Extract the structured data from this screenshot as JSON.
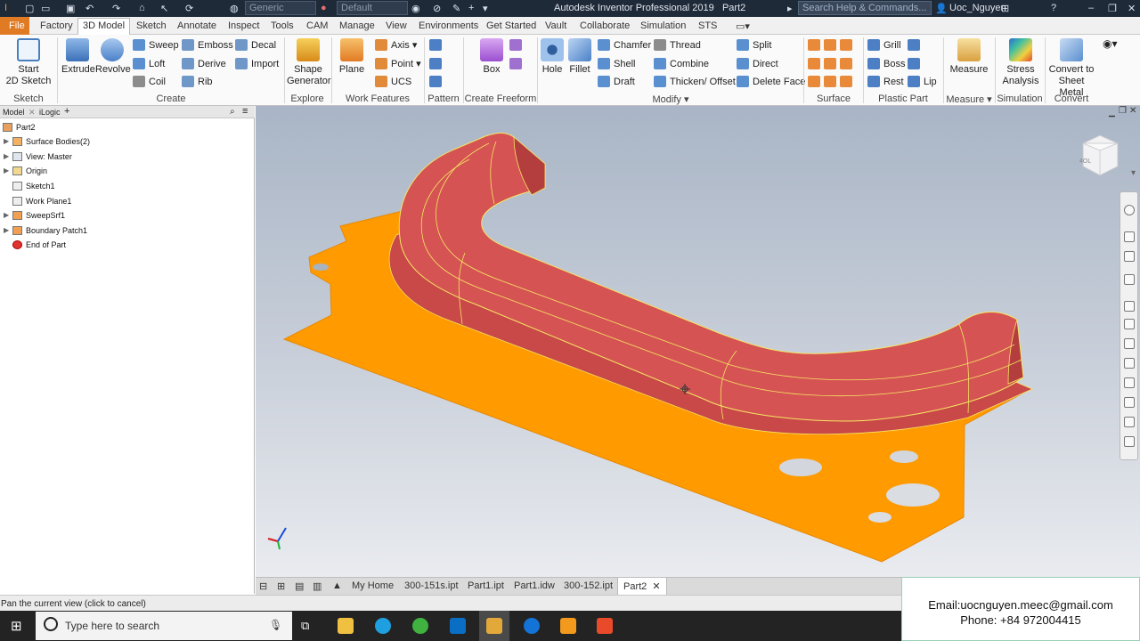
{
  "titlebar": {
    "app_title": "Autodesk Inventor Professional 2019",
    "doc_title": "Part2",
    "appearance_combo": "Generic",
    "material_combo": "Default",
    "search_placeholder": "Search Help & Commands...",
    "user": "Uoc_Nguyen"
  },
  "menu": {
    "file": "File",
    "tabs": [
      "Factory",
      "3D Model",
      "Sketch",
      "Annotate",
      "Inspect",
      "Tools",
      "CAM",
      "Manage",
      "View",
      "Environments",
      "Get Started",
      "Vault",
      "Collaborate",
      "Simulation",
      "STS"
    ],
    "active_tab": "3D Model"
  },
  "ribbon": {
    "start_sketch": "Start\n2D Sketch",
    "extrude": "Extrude",
    "revolve": "Revolve",
    "sweep": "Sweep",
    "loft": "Loft",
    "coil": "Coil",
    "emboss": "Emboss",
    "derive": "Derive",
    "rib": "Rib",
    "decal": "Decal",
    "import": "Import",
    "shape_generator": "Shape\nGenerator",
    "plane": "Plane",
    "axis": "Axis",
    "point": "Point",
    "ucs": "UCS",
    "box": "Box",
    "hole": "Hole",
    "fillet": "Fillet",
    "chamfer": "Chamfer",
    "shell": "Shell",
    "draft": "Draft",
    "thread": "Thread",
    "combine": "Combine",
    "thicken_offset": "Thicken/ Offset",
    "split": "Split",
    "direct": "Direct",
    "delete_face": "Delete Face",
    "grill": "Grill",
    "boss": "Boss",
    "rest": "Rest",
    "lip": "Lip",
    "measure": "Measure",
    "stress_analysis": "Stress\nAnalysis",
    "convert_sheet_metal": "Convert to\nSheet Metal",
    "groups": {
      "sketch": "Sketch",
      "create": "Create",
      "explore": "Explore",
      "work_features": "Work Features",
      "pattern": "Pattern",
      "create_freeform": "Create Freeform",
      "modify": "Modify",
      "surface": "Surface",
      "plastic_part": "Plastic Part",
      "measure": "Measure",
      "simulation": "Simulation",
      "convert": "Convert"
    }
  },
  "browser": {
    "tabs": [
      "Model",
      "iLogic"
    ],
    "add_tab": "+",
    "items": [
      {
        "label": "Part2",
        "icon": "part-icon"
      },
      {
        "label": "Surface Bodies(2)",
        "icon": "surface-bodies-icon"
      },
      {
        "label": "View: Master",
        "icon": "view-icon"
      },
      {
        "label": "Origin",
        "icon": "folder-icon"
      },
      {
        "label": "Sketch1",
        "icon": "sketch-icon"
      },
      {
        "label": "Work Plane1",
        "icon": "work-plane-icon"
      },
      {
        "label": "SweepSrf1",
        "icon": "sweep-surface-icon"
      },
      {
        "label": "Boundary Patch1",
        "icon": "boundary-patch-icon"
      },
      {
        "label": "End of Part",
        "icon": "end-of-part-icon"
      }
    ]
  },
  "viewcube": {
    "face": "4OL"
  },
  "doc_tabs": {
    "tabs": [
      "My Home",
      "300-151s.ipt",
      "Part1.ipt",
      "Part1.idw",
      "300-152.ipt",
      "Part2"
    ],
    "active": "Part2",
    "close": "✕"
  },
  "status": {
    "text": "Pan the current view (click to cancel)"
  },
  "contact": {
    "email": "Email:uocnguyen.meec@gmail.com",
    "phone": "Phone: +84 972004415"
  },
  "taskbar": {
    "search_placeholder": "Type here to search"
  },
  "colors": {
    "orange_surface": "#ff9a00",
    "red_sweep": "#d55353",
    "edge_highlight": "#f5e663",
    "file_tab": "#e07b24"
  }
}
